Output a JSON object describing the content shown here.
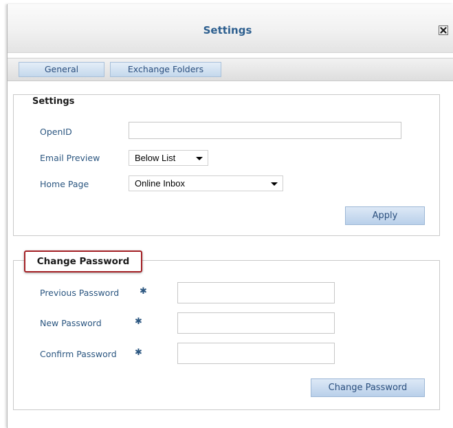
{
  "dialog": {
    "title": "Settings",
    "close_icon": "close-icon"
  },
  "tabs": [
    {
      "label": "General"
    },
    {
      "label": "Exchange Folders"
    }
  ],
  "settings": {
    "legend": "Settings",
    "openid": {
      "label": "OpenID",
      "value": ""
    },
    "email_preview": {
      "label": "Email Preview",
      "selected": "Below List"
    },
    "home_page": {
      "label": "Home Page",
      "selected": "Online Inbox"
    },
    "apply_label": "Apply"
  },
  "change_password": {
    "legend": "Change Password",
    "previous": {
      "label": "Previous Password",
      "value": ""
    },
    "new": {
      "label": "New Password",
      "value": ""
    },
    "confirm": {
      "label": "Confirm Password",
      "value": ""
    },
    "required_mark": "✱",
    "button_label": "Change Password",
    "highlight_color": "#a31f24"
  }
}
